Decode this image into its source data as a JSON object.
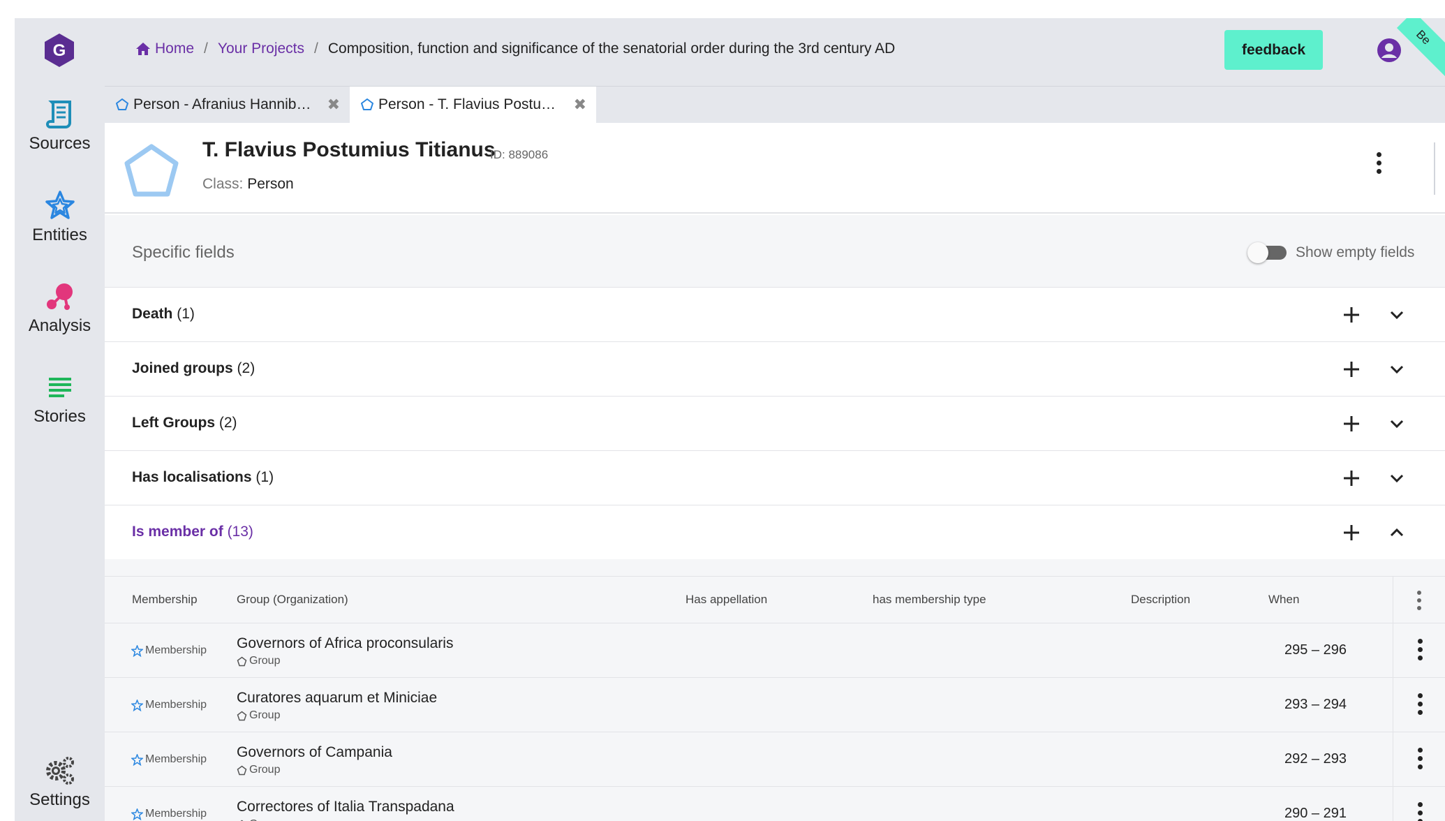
{
  "app": {
    "logo_letter": "G",
    "beta_label": "Be"
  },
  "sidebar": {
    "items": [
      {
        "label": "Sources",
        "icon": "scroll-icon",
        "color": "#1e8eb8"
      },
      {
        "label": "Entities",
        "icon": "star-icon",
        "color": "#2a86e0"
      },
      {
        "label": "Analysis",
        "icon": "analysis-icon",
        "color": "#e2367c"
      },
      {
        "label": "Stories",
        "icon": "stories-icon",
        "color": "#1fb65a"
      },
      {
        "label": "Settings",
        "icon": "gears-icon",
        "color": "#444444"
      }
    ]
  },
  "header": {
    "breadcrumb": {
      "home": "Home",
      "projects": "Your Projects",
      "current": "Composition, function and significance of the senatorial order during the 3rd century AD"
    },
    "feedback_label": "feedback"
  },
  "tabs": [
    {
      "label": "Person - Afranius Hannib…",
      "active": false
    },
    {
      "label": "Person - T. Flavius Postu…",
      "active": true
    }
  ],
  "entity": {
    "name": "T. Flavius Postumius Titianus",
    "id_text": "ID: 889086",
    "class_label": "Class:",
    "class_value": "Person"
  },
  "specific_fields": {
    "title": "Specific fields",
    "toggle_label": "Show empty fields",
    "toggle_on": false,
    "fields": [
      {
        "name": "Death",
        "count": "(1)",
        "expanded": false
      },
      {
        "name": "Joined groups",
        "count": "(2)",
        "expanded": false
      },
      {
        "name": "Left Groups",
        "count": "(2)",
        "expanded": false
      },
      {
        "name": "Has localisations",
        "count": "(1)",
        "expanded": false
      },
      {
        "name": "Is member of",
        "count": "(13)",
        "expanded": true
      }
    ]
  },
  "members_table": {
    "columns": [
      "Membership",
      "Group (Organization)",
      "Has appellation",
      "has membership type",
      "Description",
      "When"
    ],
    "rows": [
      {
        "kind": "Membership",
        "group": "Governors of Africa proconsularis",
        "group_class": "Group",
        "when": "295 – 296"
      },
      {
        "kind": "Membership",
        "group": "Curatores aquarum et Miniciae",
        "group_class": "Group",
        "when": "293 – 294"
      },
      {
        "kind": "Membership",
        "group": "Governors of Campania",
        "group_class": "Group",
        "when": "292 – 293"
      },
      {
        "kind": "Membership",
        "group": "Correctores of Italia Transpadana",
        "group_class": "Group",
        "when": "290 – 291"
      }
    ]
  },
  "colors": {
    "accent_purple": "#6a2fa6",
    "feedback_bg": "#5ef0cd",
    "entity_blue": "#9cc9f2"
  }
}
